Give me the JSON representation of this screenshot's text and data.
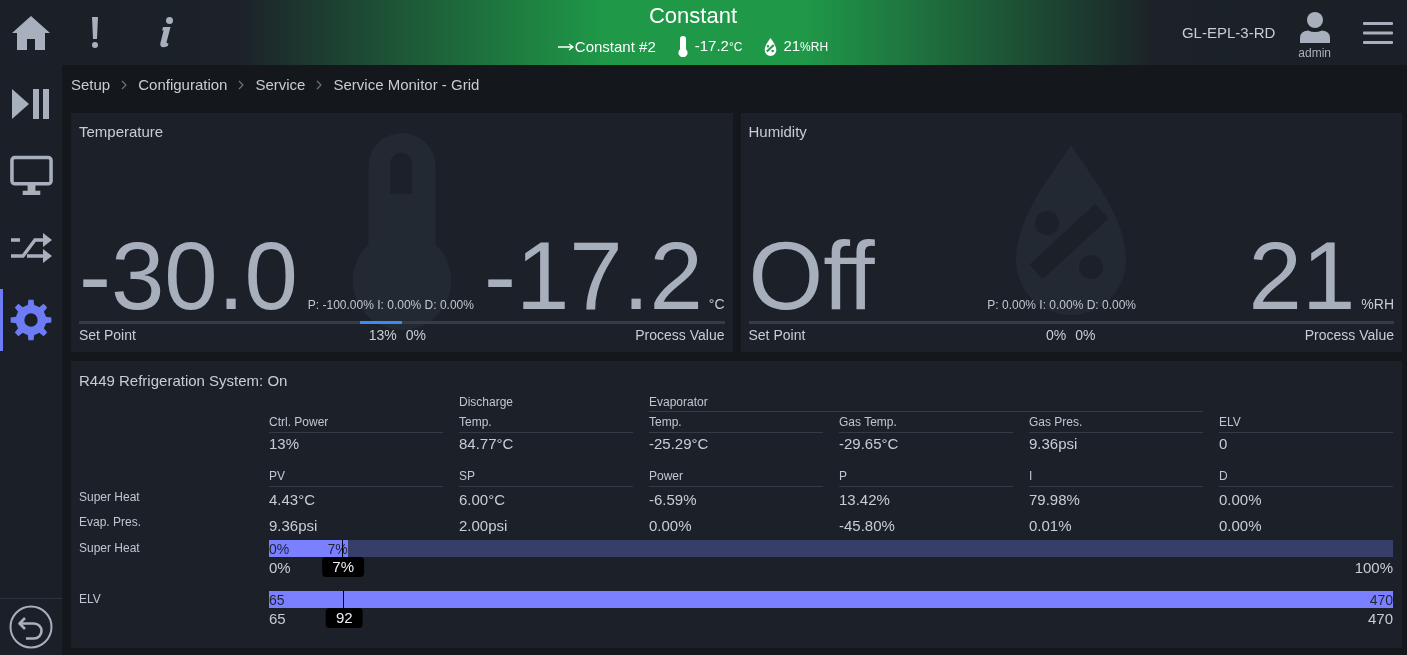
{
  "top_bar": {
    "title": "Constant",
    "step": "Constant #2",
    "temperature": {
      "value": "-17.2",
      "unit": "°C"
    },
    "humidity": {
      "value": "21",
      "unit": "%RH"
    },
    "device": "GL-EPL-3-RD",
    "user": "admin"
  },
  "sidebar": {
    "items": [
      {
        "kind": "play-pause",
        "selected": false
      },
      {
        "kind": "monitor",
        "selected": false
      },
      {
        "kind": "shuffle",
        "selected": false
      },
      {
        "kind": "gear",
        "selected": true
      }
    ]
  },
  "breadcrumb": [
    "Setup",
    "Configuration",
    "Service",
    "Service Monitor - Grid"
  ],
  "loops": [
    {
      "kind": "temperature",
      "title": "Temperature",
      "set_point": "-30.0",
      "pid": "P: -100.00% I: 0.00% D: 0.00%",
      "process_value": "-17.2",
      "unit": "°C",
      "set_point_label": "Set Point",
      "process_value_label": "Process Value",
      "left_output": {
        "level": 0.13,
        "reading": "13%"
      },
      "right_output": {
        "level": 0,
        "reading": "0%"
      }
    },
    {
      "kind": "humidity",
      "title": "Humidity",
      "set_point": "Off",
      "pid": "P: 0.00% I: 0.00% D: 0.00%",
      "process_value": "21",
      "unit": "%RH",
      "set_point_label": "Set Point",
      "process_value_label": "Process Value",
      "left_output": {
        "level": 0,
        "reading": "0%"
      },
      "right_output": {
        "level": 0,
        "reading": "0%"
      }
    }
  ],
  "refrigeration": {
    "title": "R449 Refrigeration System: On",
    "readings": [
      {
        "kind": "single",
        "label": "Ctrl. Power",
        "value": "13%"
      },
      {
        "kind": "single",
        "group": "Discharge",
        "label": "Temp.",
        "value": "84.77°C"
      },
      {
        "kind": "group",
        "group": "Evaporator",
        "items": [
          {
            "label": "Temp.",
            "value": "-25.29°C"
          },
          {
            "label": "Gas Temp.",
            "value": "-29.65°C"
          },
          {
            "label": "Gas Pres.",
            "value": "9.36psi"
          }
        ]
      },
      {
        "kind": "single",
        "label": "ELV",
        "value": "0"
      }
    ],
    "control": {
      "columns": [
        "PV",
        "SP",
        "Power",
        "P",
        "I",
        "D"
      ],
      "rows": [
        {
          "label": "Super Heat",
          "values": [
            "4.43°C",
            "6.00°C",
            "-6.59%",
            "13.42%",
            "79.98%",
            "0.00%"
          ]
        },
        {
          "label": "Evap. Pres.",
          "values": [
            "9.36psi",
            "2.00psi",
            "0.00%",
            "-45.80%",
            "0.01%",
            "0.00%"
          ]
        }
      ]
    },
    "bars": [
      {
        "label": "Super Heat",
        "level": 0.07,
        "start": "0%",
        "end": "7%",
        "min": "0%",
        "max": "100%",
        "marker": {
          "level": 0.066,
          "reading": "7%"
        }
      },
      {
        "label": "ELV",
        "level": 1,
        "start": "65",
        "end": "470",
        "min": "65",
        "max": "470",
        "marker": {
          "level": 0.067,
          "reading": "92"
        }
      }
    ]
  }
}
